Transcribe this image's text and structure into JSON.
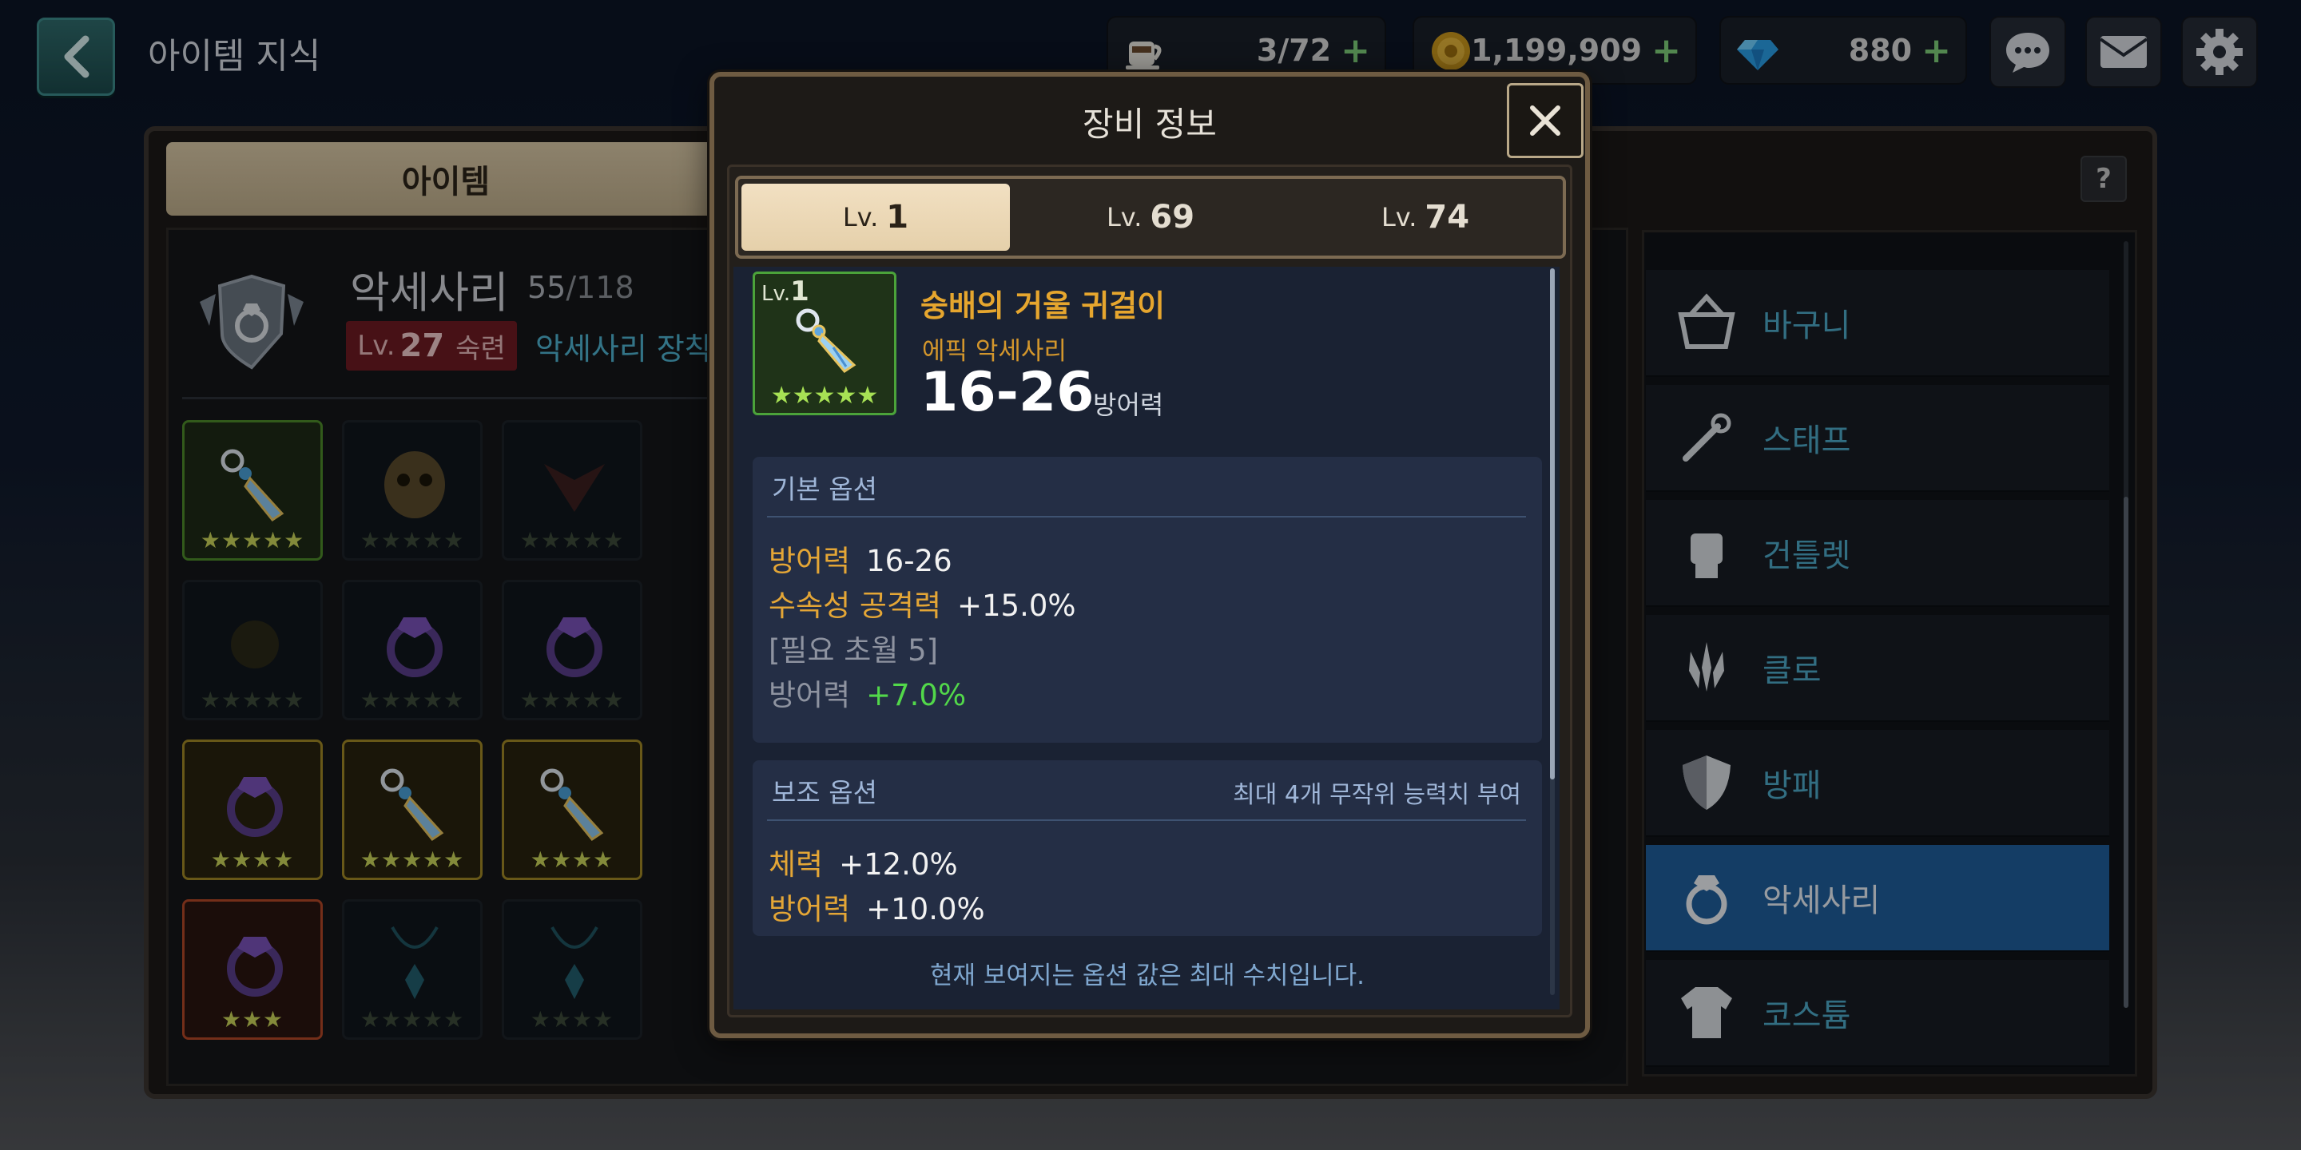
{
  "header": {
    "title": "아이템 지식",
    "stamina": "3/72",
    "gold": "1,199,909",
    "gems": "880"
  },
  "left": {
    "tab_label": "아이템",
    "category_title": "악세사리",
    "count_current": "55",
    "count_max": "/118",
    "lv_prefix": "Lv.",
    "lv_value": "27",
    "lv_suffix": "숙련",
    "equip_link": "악세사리 장착"
  },
  "grid": [
    {
      "tier": "green",
      "stars": "★★★★★",
      "icon": "earring-icon"
    },
    {
      "tier": "dark",
      "stars": "★★★★★",
      "icon": "mask-icon"
    },
    {
      "tier": "dark",
      "stars": "★★★★★",
      "icon": "demon-mask-icon"
    },
    {
      "tier": "dark",
      "stars": "★★★★★",
      "icon": "amulet-icon"
    },
    {
      "tier": "dark",
      "stars": "★★★★★",
      "icon": "ring-icon"
    },
    {
      "tier": "dark",
      "stars": "★★★★★",
      "icon": "ring-icon"
    },
    {
      "tier": "gold",
      "stars": "★★★★",
      "icon": "ring-icon"
    },
    {
      "tier": "gold",
      "stars": "★★★★★",
      "icon": "earring-icon"
    },
    {
      "tier": "gold",
      "stars": "★★★★",
      "icon": "earring-icon"
    },
    {
      "tier": "red",
      "stars": "★★★",
      "icon": "ring-icon"
    },
    {
      "tier": "dark",
      "stars": "★★★★★",
      "icon": "necklace-icon"
    },
    {
      "tier": "dark",
      "stars": "★★★★",
      "icon": "necklace-icon"
    }
  ],
  "help_label": "?",
  "categories": [
    {
      "label": "바구니",
      "icon": "basket-icon"
    },
    {
      "label": "스태프",
      "icon": "staff-icon"
    },
    {
      "label": "건틀렛",
      "icon": "gauntlet-icon"
    },
    {
      "label": "클로",
      "icon": "claw-icon"
    },
    {
      "label": "방패",
      "icon": "shield-icon"
    },
    {
      "label": "악세사리",
      "icon": "ring-icon",
      "active": true
    },
    {
      "label": "코스튬",
      "icon": "costume-icon"
    }
  ],
  "modal": {
    "title": "장비 정보",
    "tabs": [
      {
        "prefix": "Lv.",
        "value": "1",
        "active": true
      },
      {
        "prefix": "Lv.",
        "value": "69"
      },
      {
        "prefix": "Lv.",
        "value": "74"
      }
    ],
    "item": {
      "thumb_lv_prefix": "Lv.",
      "thumb_lv_value": "1",
      "thumb_stars": "★★★★★",
      "name": "숭배의 거울 귀걸이",
      "type": "에픽 악세사리",
      "value": "16-26",
      "value_label": "방어력"
    },
    "base_options": {
      "title": "기본 옵션",
      "lines": [
        {
          "k": "방어력",
          "v": "16-26"
        },
        {
          "k": "수속성 공격력",
          "v": "+15.0%"
        },
        {
          "text": "[필요 초월 5]"
        },
        {
          "k": "방어력",
          "v": "+7.0%"
        }
      ]
    },
    "sub_options": {
      "title": "보조 옵션",
      "note": "최대 4개 무작위 능력치 부여",
      "lines": [
        {
          "k": "체력",
          "v": "+12.0%"
        },
        {
          "k": "방어력",
          "v": "+10.0%"
        }
      ]
    },
    "footer": "현재 보여지는 옵션 값은 최대 수치입니다."
  }
}
